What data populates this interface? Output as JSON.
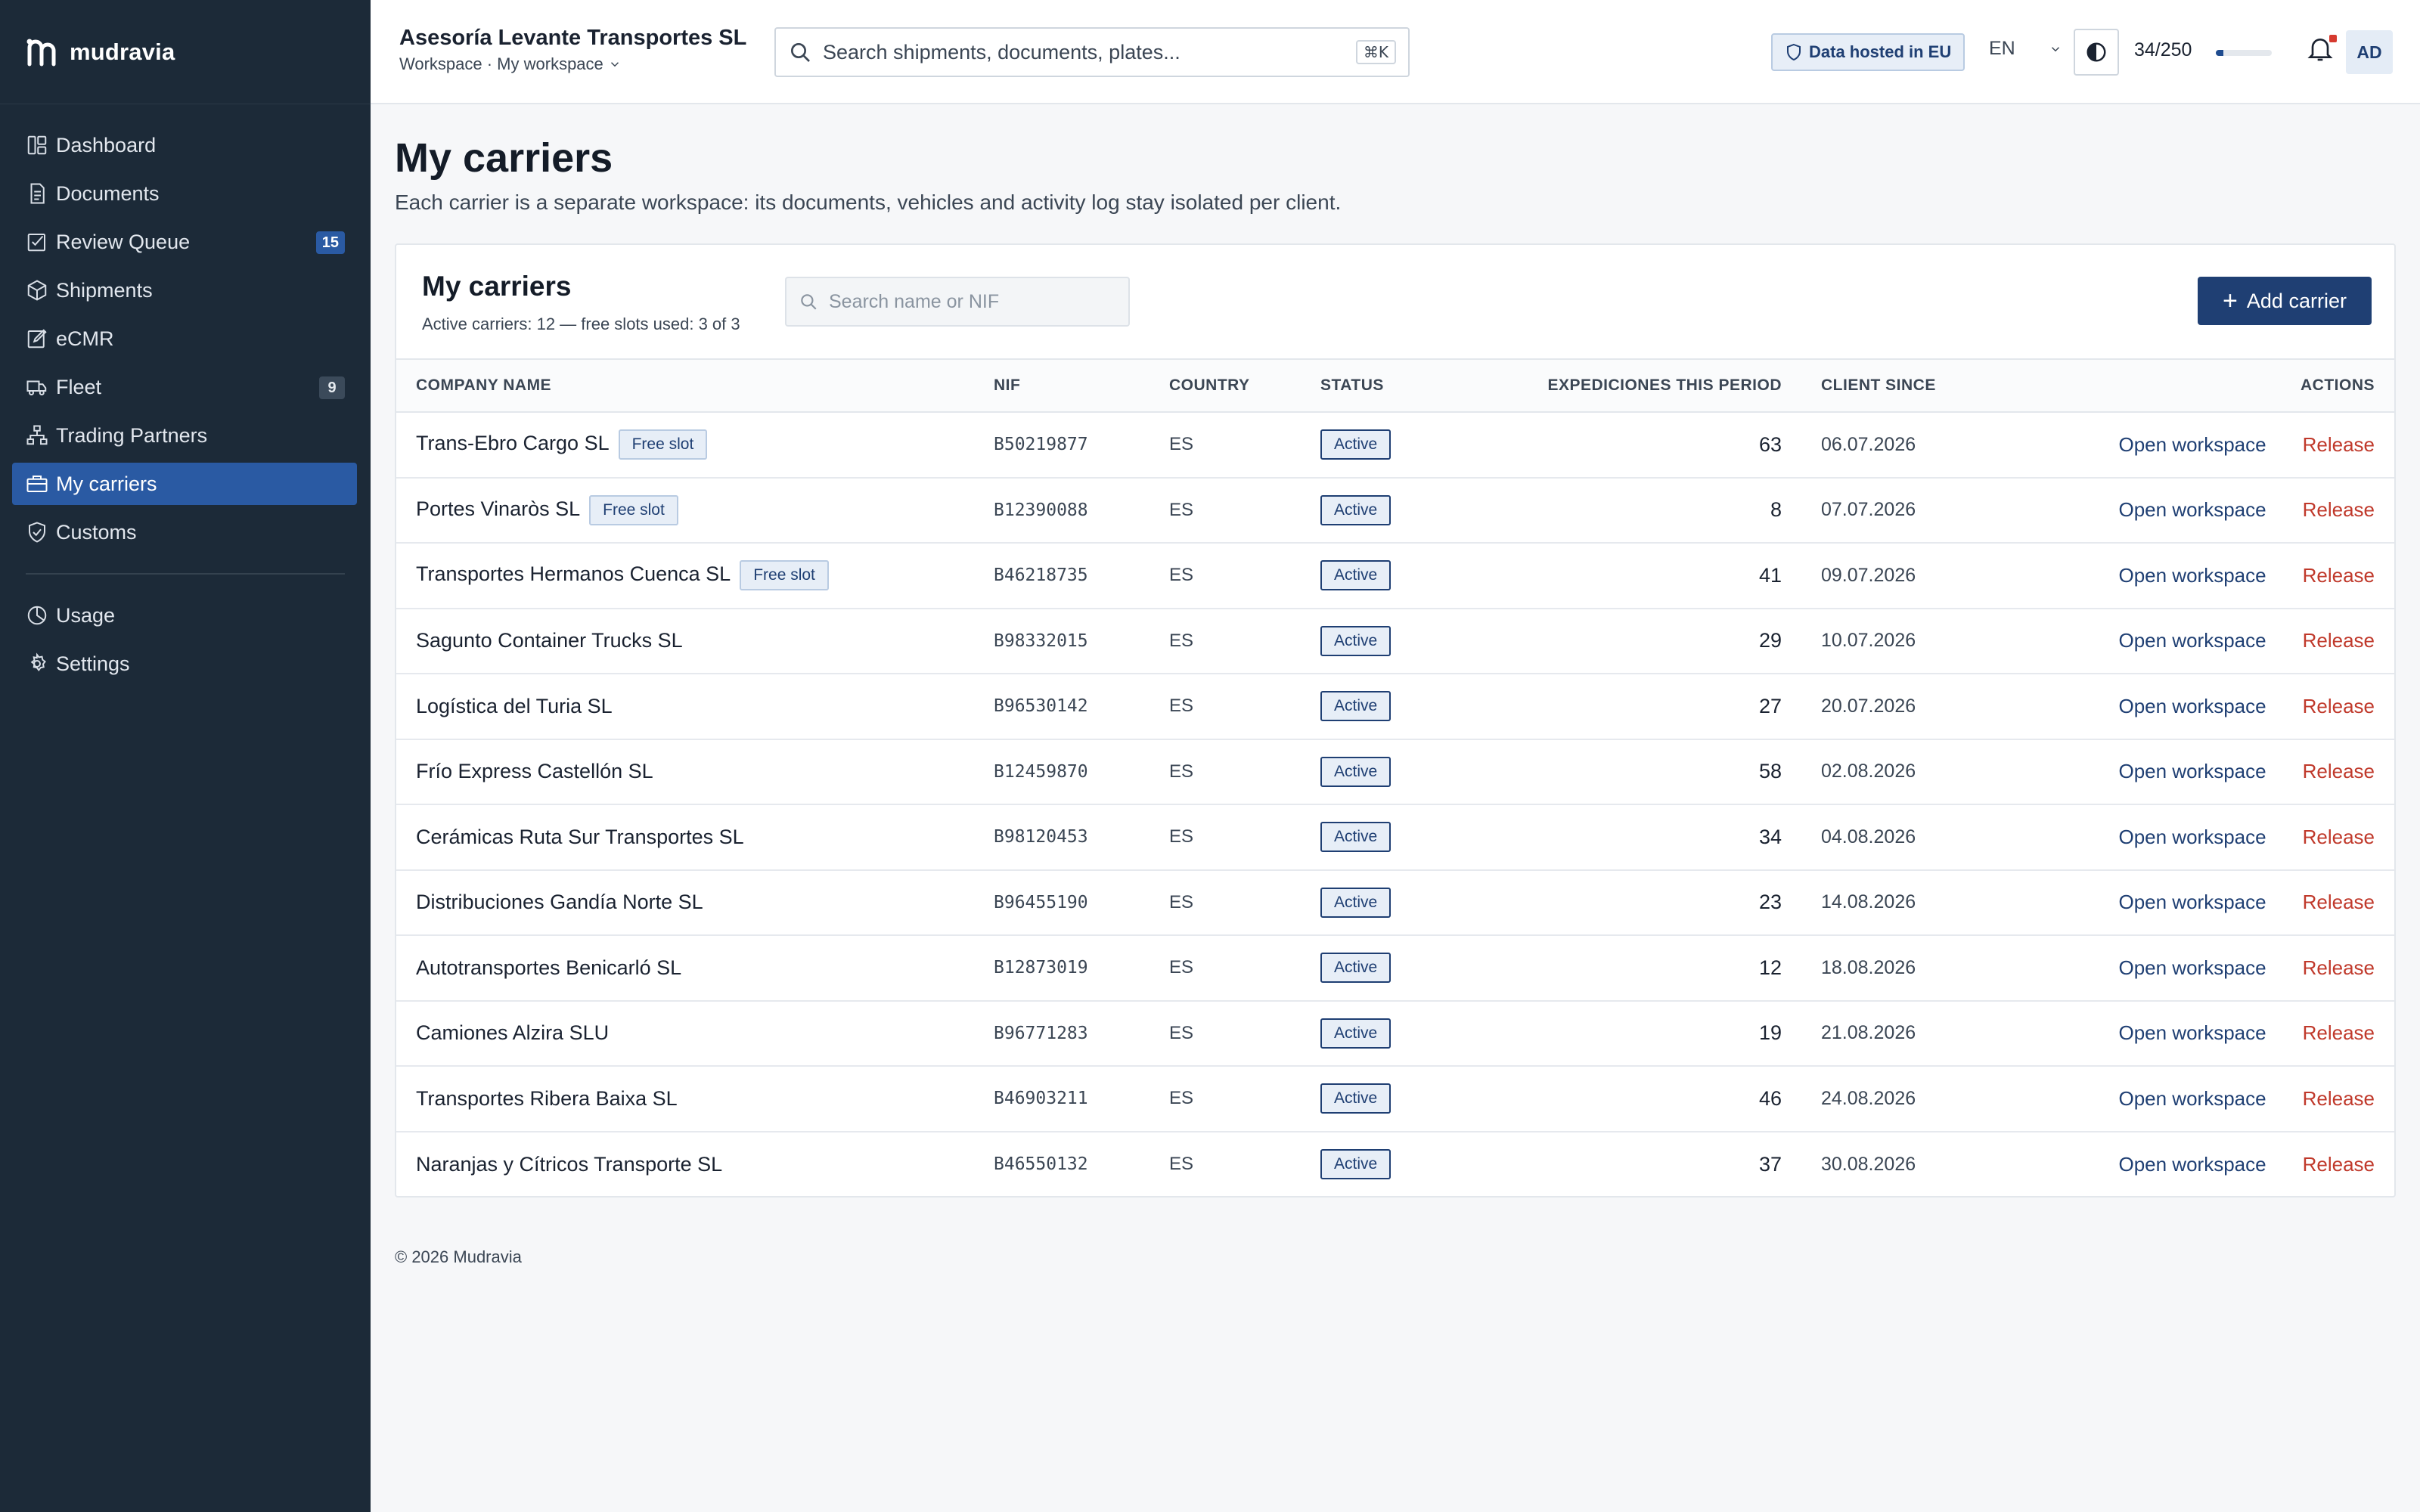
{
  "app": {
    "brand": "mudravia",
    "org_name": "Asesoría Levante Transportes SL",
    "workspace_label": "Workspace · My workspace"
  },
  "search": {
    "placeholder": "Search shipments, documents, plates...",
    "shortcut": "⌘K"
  },
  "header": {
    "eu_badge": "Data hosted in EU",
    "language": "EN",
    "usage_text": "34/250",
    "usage_fraction": 0.136,
    "avatar_initials": "AD"
  },
  "sidebar": {
    "items": [
      {
        "label": "Dashboard",
        "icon": "dashboard-icon"
      },
      {
        "label": "Documents",
        "icon": "document-icon"
      },
      {
        "label": "Review Queue",
        "icon": "review-icon",
        "badge": "15"
      },
      {
        "label": "Shipments",
        "icon": "box-icon"
      },
      {
        "label": "eCMR",
        "icon": "edit-icon"
      },
      {
        "label": "Fleet",
        "icon": "truck-icon",
        "badge": "9"
      },
      {
        "label": "Trading Partners",
        "icon": "network-icon"
      },
      {
        "label": "My carriers",
        "icon": "briefcase-icon",
        "active": true
      },
      {
        "label": "Customs",
        "icon": "shield-icon"
      },
      {
        "label": "Usage",
        "icon": "pie-icon"
      },
      {
        "label": "Settings",
        "icon": "gear-icon"
      }
    ]
  },
  "page": {
    "title": "My carriers",
    "description": "Each carrier is a separate workspace: its documents, vehicles and activity log stay isolated per client."
  },
  "card": {
    "title": "My carriers",
    "subtitle": "Active carriers: 12 — free slots used: 3 of 3",
    "search_placeholder": "Search name or NIF",
    "add_button": "Add carrier"
  },
  "table": {
    "columns": [
      "COMPANY NAME",
      "NIF",
      "COUNTRY",
      "STATUS",
      "EXPEDICIONES THIS PERIOD",
      "CLIENT SINCE",
      "ACTIONS"
    ],
    "free_slot_label": "Free slot",
    "open_label": "Open workspace",
    "release_label": "Release",
    "rows": [
      {
        "name": "Trans-Ebro Cargo SL",
        "free_slot": true,
        "nif": "B50219877",
        "country": "ES",
        "status": "Active",
        "expediciones": "63",
        "since": "06.07.2026"
      },
      {
        "name": "Portes Vinaròs SL",
        "free_slot": true,
        "nif": "B12390088",
        "country": "ES",
        "status": "Active",
        "expediciones": "8",
        "since": "07.07.2026"
      },
      {
        "name": "Transportes Hermanos Cuenca SL",
        "free_slot": true,
        "nif": "B46218735",
        "country": "ES",
        "status": "Active",
        "expediciones": "41",
        "since": "09.07.2026"
      },
      {
        "name": "Sagunto Container Trucks SL",
        "free_slot": false,
        "nif": "B98332015",
        "country": "ES",
        "status": "Active",
        "expediciones": "29",
        "since": "10.07.2026"
      },
      {
        "name": "Logística del Turia SL",
        "free_slot": false,
        "nif": "B96530142",
        "country": "ES",
        "status": "Active",
        "expediciones": "27",
        "since": "20.07.2026"
      },
      {
        "name": "Frío Express Castellón SL",
        "free_slot": false,
        "nif": "B12459870",
        "country": "ES",
        "status": "Active",
        "expediciones": "58",
        "since": "02.08.2026"
      },
      {
        "name": "Cerámicas Ruta Sur Transportes SL",
        "free_slot": false,
        "nif": "B98120453",
        "country": "ES",
        "status": "Active",
        "expediciones": "34",
        "since": "04.08.2026"
      },
      {
        "name": "Distribuciones Gandía Norte SL",
        "free_slot": false,
        "nif": "B96455190",
        "country": "ES",
        "status": "Active",
        "expediciones": "23",
        "since": "14.08.2026"
      },
      {
        "name": "Autotransportes Benicarló SL",
        "free_slot": false,
        "nif": "B12873019",
        "country": "ES",
        "status": "Active",
        "expediciones": "12",
        "since": "18.08.2026"
      },
      {
        "name": "Camiones Alzira SLU",
        "free_slot": false,
        "nif": "B96771283",
        "country": "ES",
        "status": "Active",
        "expediciones": "19",
        "since": "21.08.2026"
      },
      {
        "name": "Transportes Ribera Baixa SL",
        "free_slot": false,
        "nif": "B46903211",
        "country": "ES",
        "status": "Active",
        "expediciones": "46",
        "since": "24.08.2026"
      },
      {
        "name": "Naranjas y Cítricos Transporte SL",
        "free_slot": false,
        "nif": "B46550132",
        "country": "ES",
        "status": "Active",
        "expediciones": "37",
        "since": "30.08.2026"
      }
    ]
  },
  "footer": {
    "copyright": "© 2026 Mudravia"
  }
}
